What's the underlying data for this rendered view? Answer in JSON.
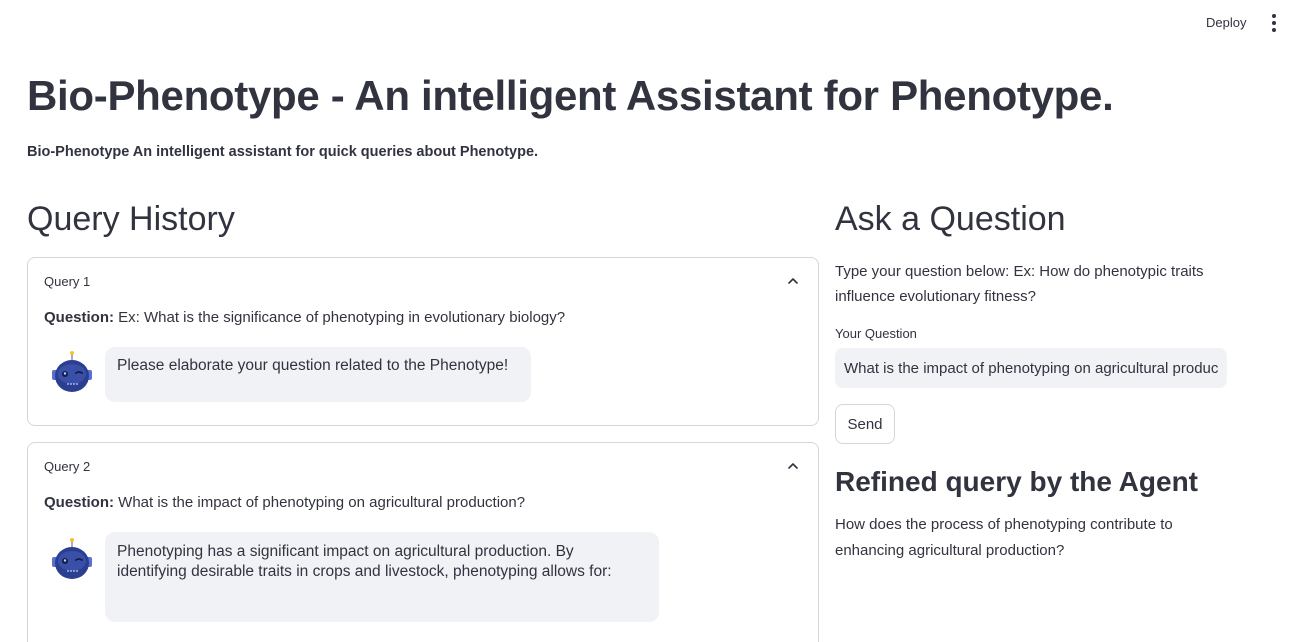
{
  "header": {
    "deploy_label": "Deploy",
    "menu_icon": "more-vertical-icon"
  },
  "page": {
    "title": "Bio-Phenotype - An intelligent Assistant for Phenotype.",
    "subtitle": "Bio-Phenotype An intelligent assistant for quick queries about Phenotype."
  },
  "history": {
    "heading": "Query History",
    "queries": [
      {
        "label": "Query 1",
        "question_prefix": "Question:",
        "question": " Ex: What is the significance of phenotyping in evolutionary biology?",
        "answer": "Please elaborate your question related to the Phenotype!"
      },
      {
        "label": "Query 2",
        "question_prefix": "Question:",
        "question": " What is the impact of phenotyping on agricultural production?",
        "answer": "Phenotyping has a significant impact on agricultural production. By identifying desirable traits in crops and livestock, phenotyping allows for:"
      }
    ]
  },
  "ask": {
    "heading": "Ask a Question",
    "instructions": "Type your question below: Ex: How do phenotypic traits influence evolutionary fitness?",
    "input_label": "Your Question",
    "input_value": "What is the impact of phenotyping on agricultural production?",
    "send_label": "Send"
  },
  "refined": {
    "heading": "Refined query by the Agent",
    "text": "How does the process of phenotyping contribute to enhancing agricultural production?"
  },
  "colors": {
    "text": "#31333f",
    "bubble_bg": "#f0f2f6",
    "border": "#d6d6d9",
    "avatar": "#2c3e8f"
  }
}
